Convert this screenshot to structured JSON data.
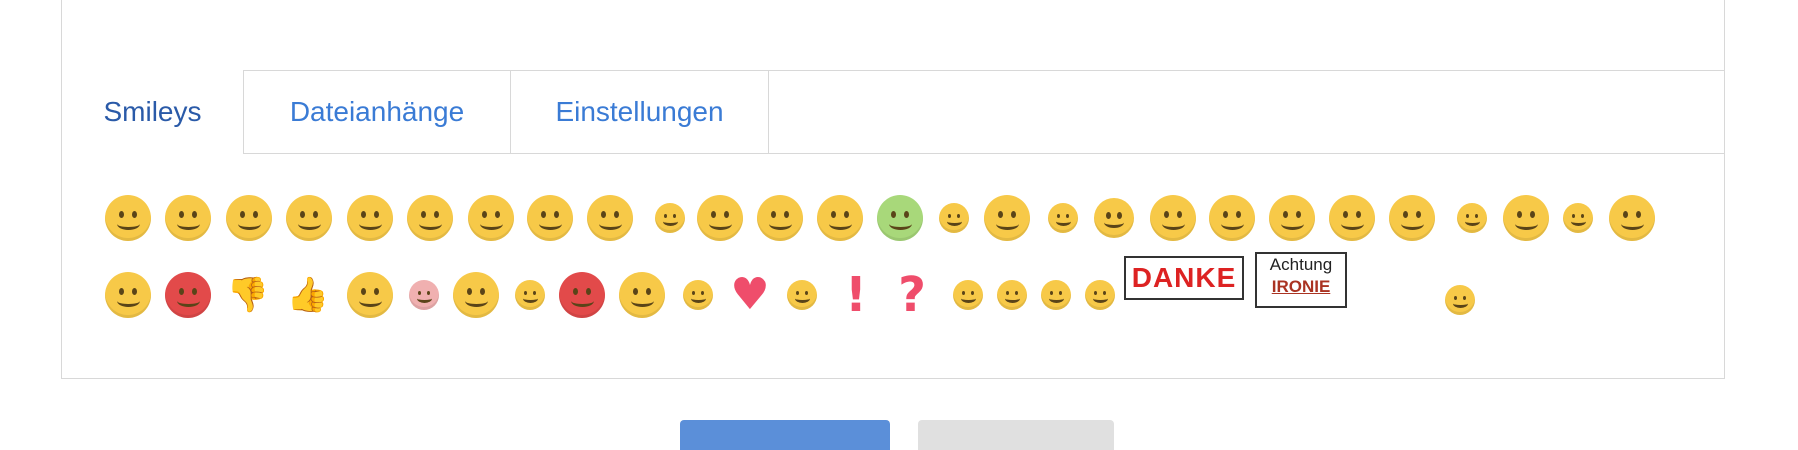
{
  "tabs": [
    {
      "label": "Smileys",
      "active": true
    },
    {
      "label": "Dateianhänge",
      "active": false
    },
    {
      "label": "Einstellungen",
      "active": false
    }
  ],
  "smileys_row1": [
    "smile",
    "frown",
    "wink",
    "tongue",
    "grin",
    "laugh",
    "cry",
    "angry",
    "kiss",
    "surprised-small",
    "neutral",
    "tongue-wink",
    "shocked",
    "sick",
    "nerd",
    "tired",
    "confused-small",
    "thinking",
    "upside-down",
    "smirk",
    "cool",
    "sad",
    "astonished",
    "grin-small",
    "rolling-eyes",
    "worried",
    "heart-eyes"
  ],
  "smileys_row2": [
    "flushed",
    "rage",
    "thumbs-down",
    "thumbs-up",
    "sleepy",
    "blush",
    "kissing",
    "frown-small",
    "devil",
    "angel",
    "cat-evil",
    "heart",
    "eek",
    "exclamation",
    "question",
    "idea",
    "arrow",
    "neutral-small",
    "teeth",
    "danke-sign",
    "achtung-sign",
    "juggle"
  ],
  "signs": {
    "danke": "DANKE",
    "achtung_top": "Achtung",
    "achtung_bottom": "IRONIE"
  },
  "symbols": {
    "exclamation": "!",
    "question": "?",
    "heart": "♥",
    "thumbs_up": "👍",
    "thumbs_down": "👎"
  },
  "colors": {
    "accent": "#3a7bd5",
    "active_tab": "#2a5aa8",
    "face": "#f7c948",
    "heart": "#ef4d6b"
  }
}
